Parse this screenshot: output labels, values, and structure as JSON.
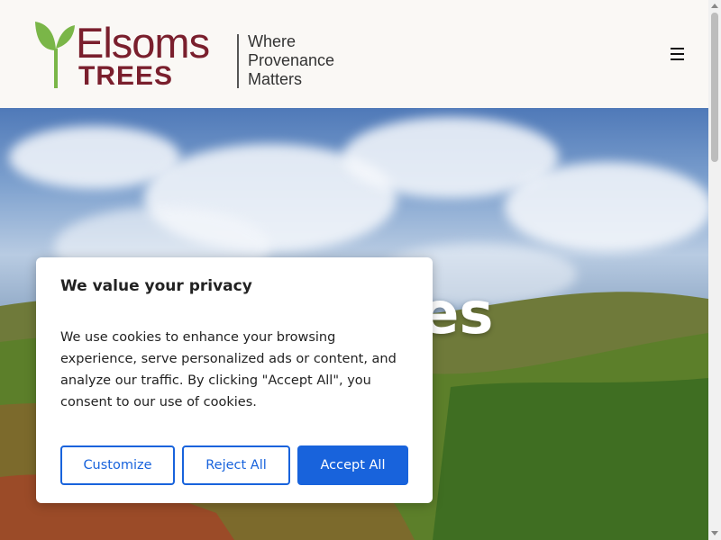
{
  "header": {
    "logo": {
      "brand_top": "Elsoms",
      "brand_bottom": "TREES",
      "tagline_line1": "Where",
      "tagline_line2": "Provenance",
      "tagline_line3": "Matters",
      "brand_color": "#7a1f2d",
      "sprout_color": "#7ab648"
    },
    "menu_icon": "hamburger-menu-icon"
  },
  "hero": {
    "heading_visible_fragment": "es"
  },
  "cookie_banner": {
    "title": "We value your privacy",
    "body": "We use cookies to enhance your browsing experience, serve personalized ads or content, and analyze our traffic. By clicking \"Accept All\", you consent to our use of cookies.",
    "customize_label": "Customize",
    "reject_label": "Reject All",
    "accept_label": "Accept All",
    "accent_color": "#1863dc"
  }
}
